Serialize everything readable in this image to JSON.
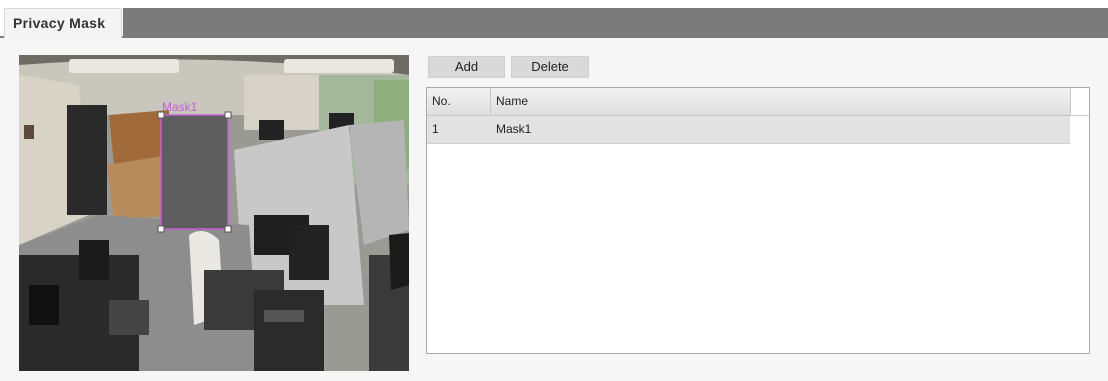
{
  "tabs": [
    {
      "label": "Privacy Mask",
      "active": true
    }
  ],
  "preview": {
    "mask_label": "Mask1"
  },
  "toolbar": {
    "add_label": "Add",
    "delete_label": "Delete"
  },
  "table": {
    "columns": [
      "No.",
      "Name"
    ],
    "rows": [
      {
        "no": "1",
        "name": "Mask1"
      }
    ]
  },
  "colors": {
    "tab_strip": "#7b7b7b",
    "mask_fill": "#5e5e5e",
    "mask_border": "#c45fd6",
    "mask_label": "#c45fd6",
    "selected_row": "#e2e2e2"
  }
}
